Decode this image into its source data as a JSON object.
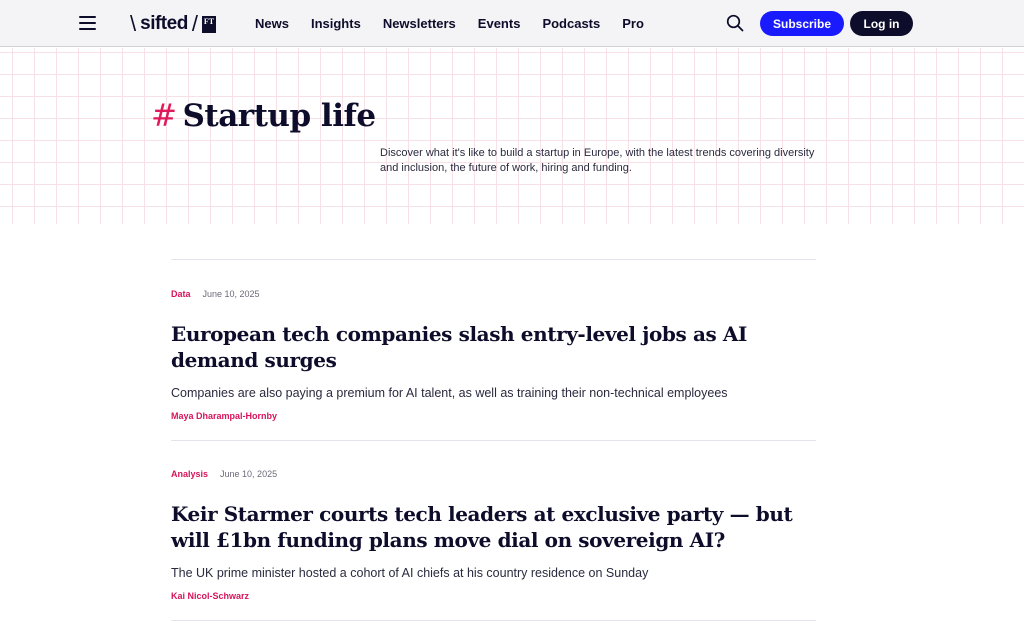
{
  "header": {
    "logo_text": "sifted",
    "logo_badge": "FT",
    "nav": [
      "News",
      "Insights",
      "Newsletters",
      "Events",
      "Podcasts",
      "Pro"
    ],
    "subscribe_label": "Subscribe",
    "login_label": "Log in",
    "colors": {
      "subscribe_bg": "#1a1aff",
      "login_bg": "#0d0d2b",
      "accent": "#e0195a"
    }
  },
  "hero": {
    "hash": "#",
    "title": "Startup life",
    "description": "Discover what it's like to build a startup in Europe, with the latest trends covering diversity and inclusion, the future of work, hiring and funding."
  },
  "articles": [
    {
      "category": "Data",
      "date": "June 10, 2025",
      "headline": "European tech companies slash entry-level jobs as AI demand surges",
      "standfirst": "Companies are also paying a premium for AI talent, as well as training their non-technical employees",
      "author": "Maya Dharampal-Hornby"
    },
    {
      "category": "Analysis",
      "date": "June 10, 2025",
      "headline": "Keir Starmer courts tech leaders at exclusive party — but will £1bn funding plans move dial on sovereign AI?",
      "standfirst": "The UK prime minister hosted a cohort of AI chiefs at his country residence on Sunday",
      "author": "Kai Nicol-Schwarz"
    }
  ]
}
